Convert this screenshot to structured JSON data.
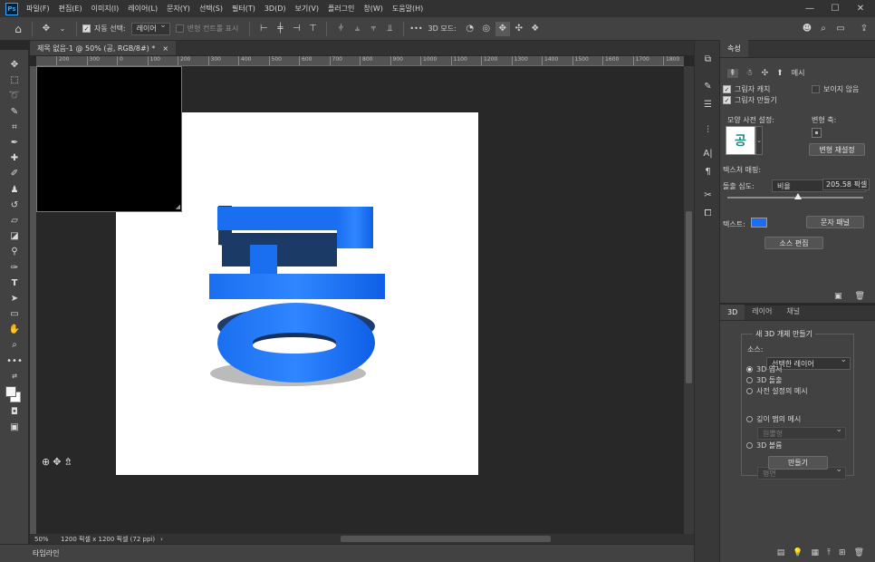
{
  "menubar": {
    "items": [
      "파일(F)",
      "편집(E)",
      "이미지(I)",
      "레이어(L)",
      "문자(Y)",
      "선택(S)",
      "필터(T)",
      "3D(D)",
      "보기(V)",
      "플러그인",
      "창(W)",
      "도움말(H)"
    ],
    "logo": "Ps",
    "minimize": "—",
    "maximize": "☐",
    "close": "✕"
  },
  "options": {
    "home_icon": "home-icon",
    "auto_select_label": "자동 선택:",
    "auto_select_value": "레이어",
    "transform_label": "변형 컨트롤 표시",
    "more": "•••",
    "mode3d_label": "3D 모드:"
  },
  "document": {
    "tab_title": "제목 없음-1 @ 50% (공, RGB/8#) *",
    "tab_close": "×",
    "artwork_text": "공",
    "text_color": "#1a73e8"
  },
  "ruler": {
    "ticks": [
      "200",
      "300",
      "0",
      "100",
      "200",
      "300",
      "400",
      "500",
      "600",
      "700",
      "800",
      "900",
      "1000",
      "1100",
      "1200",
      "1300",
      "1400",
      "1500",
      "1600",
      "1700",
      "1800"
    ]
  },
  "status": {
    "zoom": "50%",
    "info": "1200 픽셀 x 1200 픽셀 (72 ppi)",
    "arrow": "›"
  },
  "timeline": {
    "label": "타임라인"
  },
  "props": {
    "tab": "속성",
    "subtab_mesh": "메시",
    "catch_shadow": "그림자 캐치",
    "cast_shadow": "그림자 만들기",
    "invisible": "보이지 않음",
    "shape_preset": "모양 사전 설정:",
    "deform_axis": "변형 축:",
    "reset_deform": "변형 재설정",
    "texture_map_label": "텍스처 매핑:",
    "texture_map_value": "비율",
    "extrude_depth_label": "돌출 심도:",
    "extrude_depth_value": "205.58 픽셀",
    "extrude_fraction": 0.52,
    "text_label": "텍스트:",
    "text_swatch": "#1a6ef5",
    "char_panel": "문자 패널",
    "edit_source": "소스 편집"
  },
  "panel3d": {
    "tabs": [
      "3D",
      "레이어",
      "채널"
    ],
    "title": "새 3D 개체 만들기",
    "source_label": "소스:",
    "source_value": "선택한 레이어",
    "options": [
      {
        "label": "3D 엽서",
        "on": true,
        "disabled": false
      },
      {
        "label": "3D 돌출",
        "on": false,
        "disabled": false
      },
      {
        "label": "사전 설정의 메시",
        "on": false,
        "disabled": false
      },
      {
        "label": "깊이 맵의 메시",
        "on": false,
        "disabled": false
      },
      {
        "label": "3D 볼륨",
        "on": false,
        "disabled": false
      }
    ],
    "preset_select": "원뿔형",
    "depth_select": "평면",
    "create_button": "만들기"
  }
}
